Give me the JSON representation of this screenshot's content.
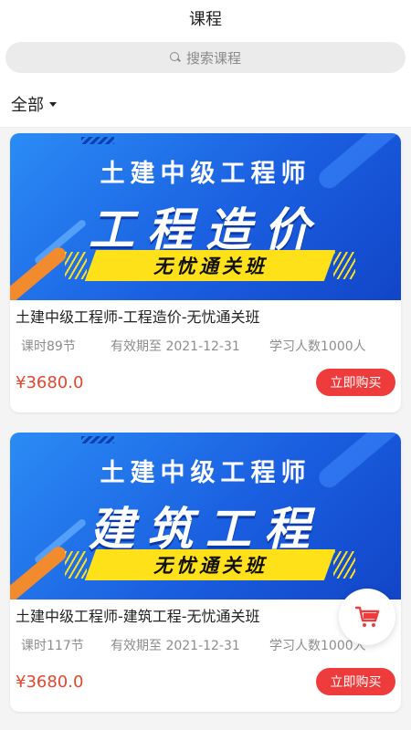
{
  "header": {
    "title": "课程"
  },
  "search": {
    "placeholder": "搜索课程",
    "icon": "search-icon"
  },
  "filter": {
    "label": "全部",
    "icon": "caret-down-icon"
  },
  "courses": [
    {
      "banner": {
        "line1": "土建中级工程师",
        "line2": "工程造价",
        "ribbon": "无忧通关班"
      },
      "name": "土建中级工程师-工程造价-无忧通关班",
      "lessons": "课时89节",
      "validity": "有效期至 2021-12-31",
      "learners": "学习人数1000人",
      "price": "¥3680.0",
      "buy_label": "立即购买"
    },
    {
      "banner": {
        "line1": "土建中级工程师",
        "line2": "建筑工程",
        "ribbon": "无忧通关班"
      },
      "name": "土建中级工程师-建筑工程-无忧通关班",
      "lessons": "课时117节",
      "validity": "有效期至 2021-12-31",
      "learners": "学习人数1000人",
      "price": "¥3680.0",
      "buy_label": "立即购买"
    }
  ],
  "cart": {
    "icon": "cart-icon"
  },
  "colors": {
    "accent": "#ee3b3b",
    "price": "#e4462e",
    "banner": "#1a5fe0",
    "ribbon": "#ffe11a"
  }
}
